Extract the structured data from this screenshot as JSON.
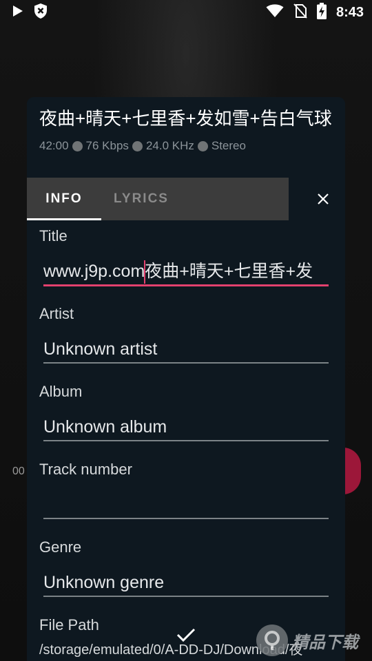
{
  "status_bar": {
    "time": "8:43",
    "icons_left": [
      "play-icon",
      "shield-icon"
    ],
    "icons_right": [
      "wifi-icon",
      "no-sim-icon",
      "battery-charging-icon"
    ]
  },
  "background": {
    "time_partial": "00",
    "fab_color": "#9c1739"
  },
  "dialog": {
    "title": "夜曲+晴天+七里香+发如雪+告白气球",
    "meta": {
      "duration": "42:00",
      "bitrate": "76 Kbps",
      "sample_rate": "24.0 KHz",
      "channels": "Stereo"
    },
    "tabs": [
      {
        "label": "INFO",
        "active": true
      },
      {
        "label": "LYRICS",
        "active": false
      }
    ],
    "close_icon": "close-icon",
    "fields": {
      "title": {
        "label": "Title",
        "value_before_cursor": "www.j9p.com",
        "value_after_cursor": "夜曲+晴天+七里香+发"
      },
      "artist": {
        "label": "Artist",
        "value": "Unknown artist"
      },
      "album": {
        "label": "Album",
        "value": "Unknown album"
      },
      "track_number": {
        "label": "Track number",
        "value": ""
      },
      "genre": {
        "label": "Genre",
        "value": "Unknown genre"
      }
    },
    "file_path": {
      "label": "File Path",
      "value": "/storage/emulated/0/A-DD-DJ/Download/夜"
    },
    "confirm_icon": "checkmark-icon"
  },
  "watermark": {
    "text": "精品下载"
  },
  "colors": {
    "accent": "#e3416e",
    "dialog_bg": "#0e1820",
    "tab_bar_bg": "#3c3c3c"
  }
}
